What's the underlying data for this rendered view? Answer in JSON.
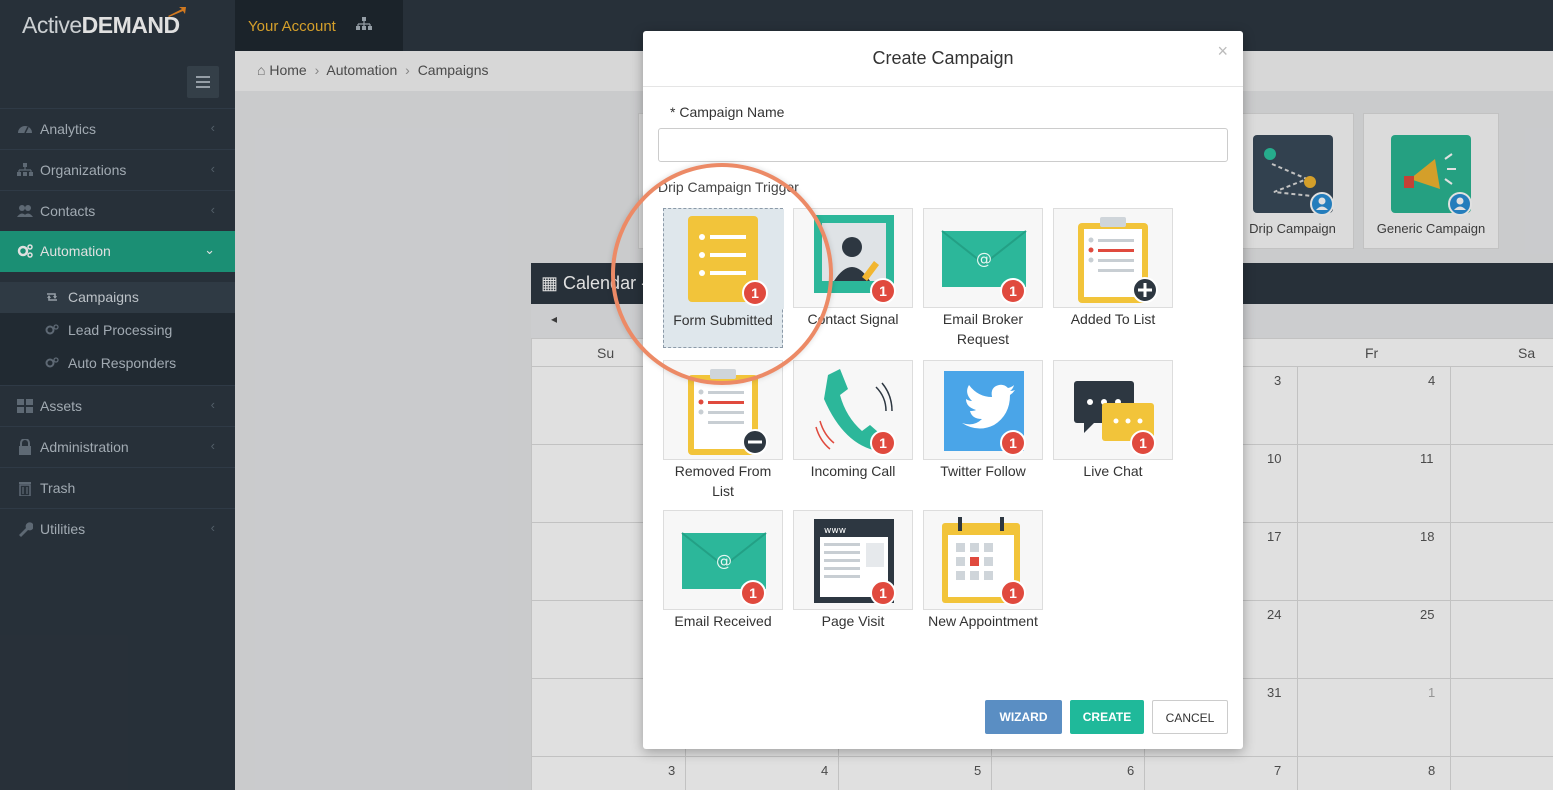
{
  "brand": {
    "part1": "Active",
    "part2": "DEMAND"
  },
  "header": {
    "account_label": "Your Account"
  },
  "sidebar": {
    "items": [
      {
        "label": "Analytics"
      },
      {
        "label": "Organizations"
      },
      {
        "label": "Contacts"
      },
      {
        "label": "Automation"
      },
      {
        "label": "Assets"
      },
      {
        "label": "Administration"
      },
      {
        "label": "Trash"
      },
      {
        "label": "Utilities"
      }
    ],
    "subitems": [
      {
        "label": "Campaigns"
      },
      {
        "label": "Lead Processing"
      },
      {
        "label": "Auto Responders"
      }
    ]
  },
  "breadcrumb": {
    "home": "Home",
    "section": "Automation",
    "page": "Campaigns"
  },
  "tiles": {
    "drip": "Drip Campaign",
    "generic": "Generic Campaign"
  },
  "calendar": {
    "title": "Calendar -",
    "prev": "◂",
    "days": {
      "su": "Su",
      "fr": "Fr",
      "sa": "Sa"
    },
    "numbers": [
      "3",
      "4",
      "10",
      "11",
      "17",
      "18",
      "24",
      "25",
      "31",
      "1",
      "3",
      "4",
      "5",
      "6",
      "7",
      "8"
    ]
  },
  "modal": {
    "title": "Create Campaign",
    "close": "×",
    "name_label": "* Campaign Name",
    "name_value": "",
    "trigger_label": "Drip Campaign Trigger",
    "triggers": [
      {
        "label": "Form Submitted",
        "badge": "1"
      },
      {
        "label": "Contact Signal",
        "badge": "1"
      },
      {
        "label": "Email Broker Request",
        "badge": "1"
      },
      {
        "label": "Added To List"
      },
      {
        "label": "Removed From List"
      },
      {
        "label": "Incoming Call",
        "badge": "1"
      },
      {
        "label": "Twitter Follow",
        "badge": "1"
      },
      {
        "label": "Live Chat",
        "badge": "1"
      },
      {
        "label": "Email Received",
        "badge": "1"
      },
      {
        "label": "Page Visit",
        "badge": "1"
      },
      {
        "label": "New Appointment",
        "badge": "1"
      }
    ],
    "buttons": {
      "wizard": "WIZARD",
      "create": "CREATE",
      "cancel": "CANCEL"
    }
  },
  "colors": {
    "accent": "#1fa385",
    "sidebar": "#2d3741",
    "badge": "#e04a3e",
    "highlight": "#ec8a66",
    "wizard": "#5a8ec3",
    "create": "#1fb99a"
  }
}
